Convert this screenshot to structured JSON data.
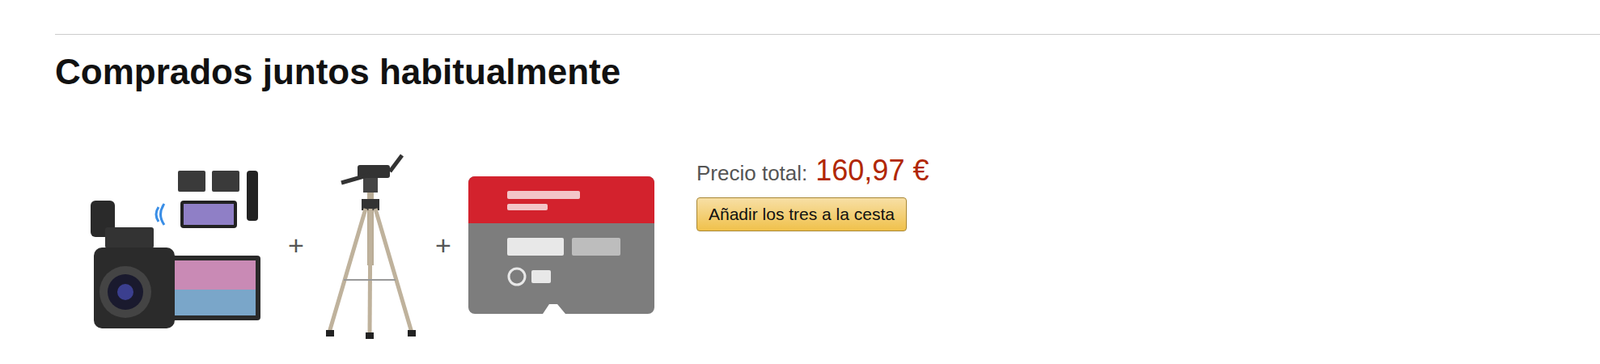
{
  "section": {
    "title": "Comprados juntos habitualmente"
  },
  "products": [
    {
      "kind": "camera"
    },
    {
      "kind": "tripod"
    },
    {
      "kind": "sd-card"
    }
  ],
  "separator": "+",
  "total": {
    "label": "Precio total:",
    "price": "160,97 €"
  },
  "button": {
    "label": "Añadir los tres a la cesta"
  }
}
